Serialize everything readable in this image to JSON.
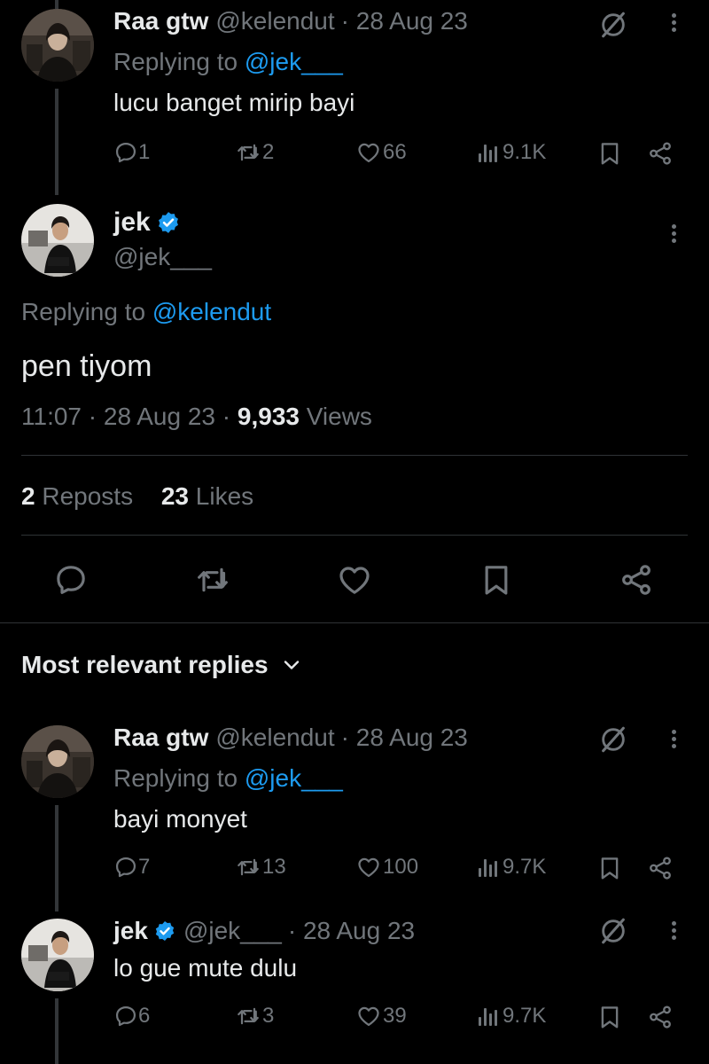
{
  "colors": {
    "background": "#000000",
    "text": "#e7e9ea",
    "muted": "#71767b",
    "accent": "#1d9bf0",
    "divider": "#2f3336"
  },
  "parent_reply": {
    "name": "Raa gtw",
    "handle": "@kelendut",
    "date": "· 28 Aug 23",
    "replying_prefix": "Replying to",
    "replying_to": "@jek___",
    "text": "lucu banget mirip bayi",
    "replies": "1",
    "reposts": "2",
    "likes": "66",
    "views": "9.1K"
  },
  "main_tweet": {
    "name": "jek",
    "handle": "@jek___",
    "replying_prefix": "Replying to",
    "replying_to": "@kelendut",
    "text": "pen tiyom",
    "time": "11:07 · 28 Aug 23 ·",
    "views_count": "9,933",
    "views_label": "Views",
    "reposts_count": "2",
    "reposts_label": "Reposts",
    "likes_count": "23",
    "likes_label": "Likes"
  },
  "sort": {
    "label": "Most relevant replies"
  },
  "reply1": {
    "name": "Raa gtw",
    "handle": "@kelendut",
    "date": "· 28 Aug 23",
    "replying_prefix": "Replying to",
    "replying_to": "@jek___",
    "text": "bayi monyet",
    "replies": "7",
    "reposts": "13",
    "likes": "100",
    "views": "9.7K"
  },
  "reply2": {
    "name": "jek",
    "handle": "@jek___",
    "date": "· 28 Aug 23",
    "text": "lo gue mute dulu",
    "replies": "6",
    "reposts": "3",
    "likes": "39",
    "views": "9.7K"
  },
  "icons": [
    "more-icon",
    "grok-icon",
    "reply-icon",
    "repost-icon",
    "like-icon",
    "views-icon",
    "bookmark-icon",
    "share-icon",
    "verified-icon",
    "chevron-down-icon"
  ]
}
